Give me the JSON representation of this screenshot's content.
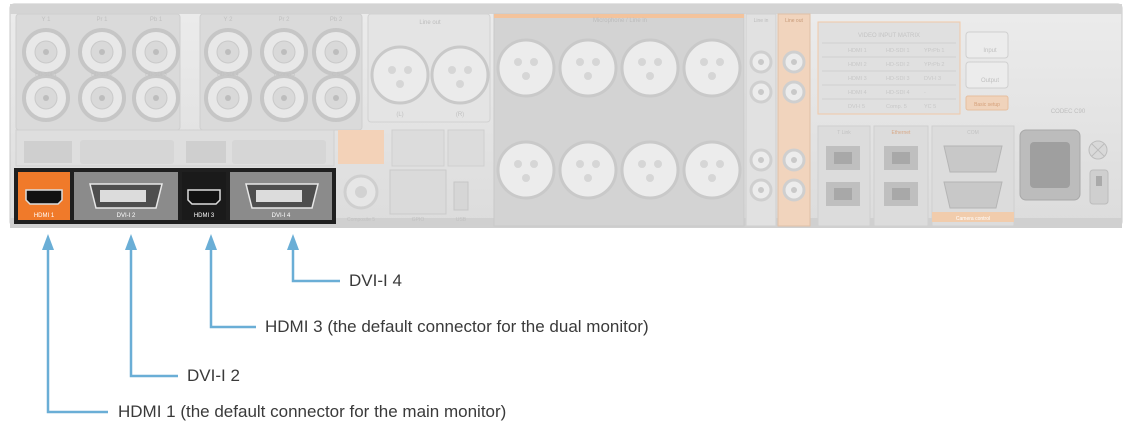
{
  "panel": {
    "top_labels": [
      "Y 1",
      "Pr 1",
      "Pb 1",
      "Y 2",
      "Pr 2",
      "Pb 2"
    ],
    "line_out": {
      "title": "Line out",
      "left": "(L)",
      "right": "(R)"
    },
    "mic_title": "Microphone / Line in",
    "line_in": "Line in",
    "line_out_small": "Line out",
    "hd_sdi_labels": [
      "HD-SDI 1",
      "HD-SDI 2",
      "HD-SDI 3",
      "HD-SDI 4",
      "Y/Comp 5",
      "C 5"
    ],
    "matrix": {
      "title": "VIDEO INPUT MATRIX",
      "rows": [
        [
          "HDMI 1",
          "HD-SDI 1",
          "YPrPb 1"
        ],
        [
          "HDMI 2",
          "HD-SDI 2",
          "YPrPb 2"
        ],
        [
          "HDMI 3",
          "HD-SDI 3",
          "DVI-I 3"
        ],
        [
          "HDMI 4",
          "HD-SDI 4",
          "-"
        ],
        [
          "DVI-I 5",
          "Comp. 5",
          "YC 5"
        ]
      ]
    },
    "input_btn": "Input",
    "output_btn": "Output",
    "basic_setup": "Basic setup",
    "codec_name": "CODEC C90",
    "bottom_labels": [
      "HDMI 1",
      "DVI-I 2",
      "HDMI 3",
      "DVI-I 4"
    ],
    "misc_labels": [
      "Composite 5",
      "GPIO",
      "USB",
      "T Link",
      "Ethernet",
      "COM",
      "Camera control"
    ]
  },
  "callouts": [
    {
      "text": "DVI-I 4",
      "color": "#6aaed6"
    },
    {
      "text": "HDMI 3 (the default connector for the dual monitor)",
      "color": "#6aaed6"
    },
    {
      "text": "DVI-I 2",
      "color": "#6aaed6"
    },
    {
      "text": "HDMI 1 (the default connector for the main monitor)",
      "color": "#6aaed6"
    }
  ],
  "colors": {
    "accent_orange": "#f07a2a",
    "connector_gray": "#7a7a7a",
    "leader_blue": "#6aaed6"
  },
  "icons": [
    "bnc-connector-icon",
    "xlr-connector-icon",
    "hdmi-port-icon",
    "dvi-port-icon",
    "rca-connector-icon",
    "ethernet-port-icon",
    "db9-port-icon",
    "power-inlet-icon",
    "ground-screw-icon"
  ]
}
